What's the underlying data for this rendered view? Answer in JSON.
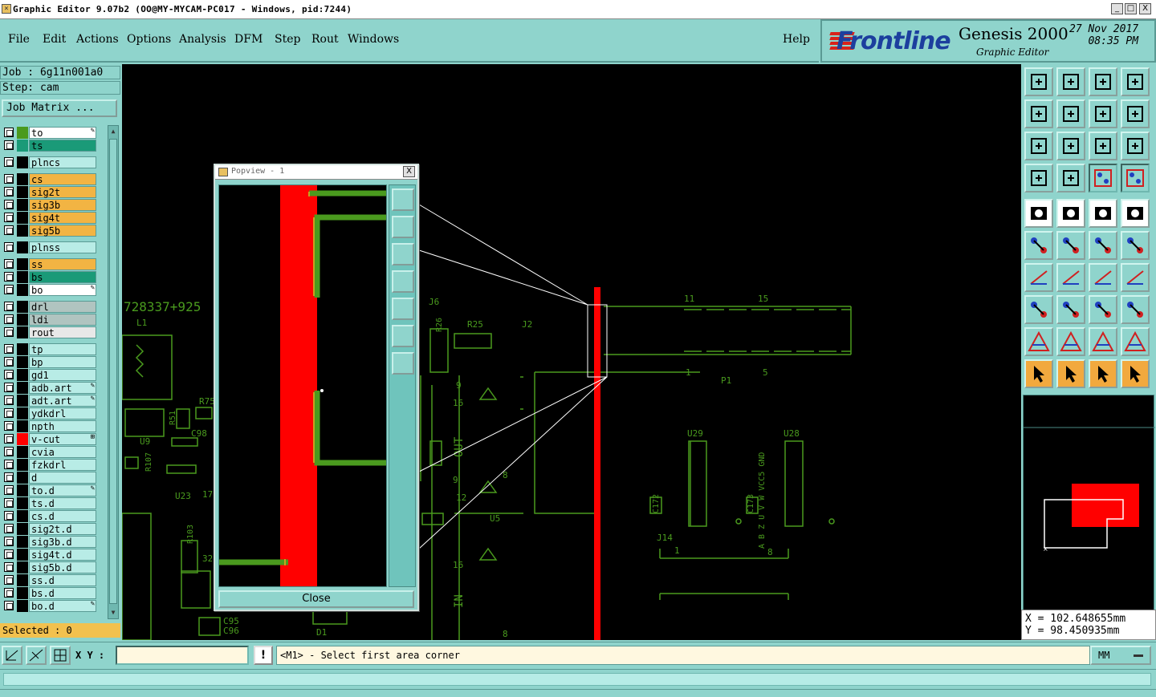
{
  "window": {
    "title": "Graphic Editor 9.07b2 (OO@MY-MYCAM-PC017 - Windows, pid:7244)",
    "minimize": "_",
    "maximize": "□",
    "close": "X"
  },
  "menu": {
    "file": "File",
    "edit": "Edit",
    "actions": "Actions",
    "options": "Options",
    "analysis": "Analysis",
    "dfm": "DFM",
    "step": "Step",
    "rout": "Rout",
    "windows": "Windows",
    "help": "Help"
  },
  "brand": {
    "logo": "Frontline",
    "product": "Genesis 2000",
    "subtitle": "Graphic Editor",
    "date": "27 Nov 2017",
    "time": "08:35 PM"
  },
  "job": {
    "job_label": "Job : 6g11n001a0",
    "step_label": "Step: cam",
    "matrix_button": "Job Matrix ..."
  },
  "layers": [
    {
      "name": "to",
      "color": "#4a9a1e",
      "bg": "#ffffff",
      "mark": "✎"
    },
    {
      "name": "ts",
      "color": "#1a9a78",
      "bg": "#1a9a78",
      "mark": ""
    },
    {
      "name": "plncs",
      "color": "#8fd4cc",
      "bg": "#b8ece6",
      "mark": ""
    },
    {
      "name": "cs",
      "color": "#f2b443",
      "bg": "#f2b443",
      "mark": ""
    },
    {
      "name": "sig2t",
      "color": "#f2b443",
      "bg": "#f2b443",
      "mark": ""
    },
    {
      "name": "sig3b",
      "color": "#f2b443",
      "bg": "#f2b443",
      "mark": ""
    },
    {
      "name": "sig4t",
      "color": "#f2b443",
      "bg": "#f2b443",
      "mark": ""
    },
    {
      "name": "sig5b",
      "color": "#f2b443",
      "bg": "#f2b443",
      "mark": ""
    },
    {
      "name": "plnss",
      "color": "#8fd4cc",
      "bg": "#b8ece6",
      "mark": ""
    },
    {
      "name": "ss",
      "color": "#f2b443",
      "bg": "#f2b443",
      "mark": ""
    },
    {
      "name": "bs",
      "color": "#1a9a78",
      "bg": "#1a9a78",
      "mark": ""
    },
    {
      "name": "bo",
      "color": "#ffffff",
      "bg": "#ffffff",
      "mark": "✎"
    },
    {
      "name": "drl",
      "color": "#8aa8a4",
      "bg": "#b0c4c0",
      "mark": ""
    },
    {
      "name": "ldi",
      "color": "#8aa8a4",
      "bg": "#b0c4c0",
      "mark": ""
    },
    {
      "name": "rout",
      "color": "#d0d0d0",
      "bg": "#e8e8e8",
      "mark": ""
    },
    {
      "name": "tp",
      "color": "#8fd4cc",
      "bg": "#b8ece6",
      "mark": ""
    },
    {
      "name": "bp",
      "color": "#8fd4cc",
      "bg": "#b8ece6",
      "mark": ""
    },
    {
      "name": "gd1",
      "color": "#8fd4cc",
      "bg": "#b8ece6",
      "mark": ""
    },
    {
      "name": "adb.art",
      "color": "#8fd4cc",
      "bg": "#b8ece6",
      "mark": "✎"
    },
    {
      "name": "adt.art",
      "color": "#8fd4cc",
      "bg": "#b8ece6",
      "mark": "✎"
    },
    {
      "name": "ydkdrl",
      "color": "#8fd4cc",
      "bg": "#b8ece6",
      "mark": ""
    },
    {
      "name": "npth",
      "color": "#8fd4cc",
      "bg": "#b8ece6",
      "mark": ""
    },
    {
      "name": "v-cut",
      "color": "#ff0000",
      "bg": "#b8ece6",
      "mark": "⊞"
    },
    {
      "name": "cvia",
      "color": "#8fd4cc",
      "bg": "#b8ece6",
      "mark": ""
    },
    {
      "name": "fzkdrl",
      "color": "#8fd4cc",
      "bg": "#b8ece6",
      "mark": ""
    },
    {
      "name": "d",
      "color": "#8fd4cc",
      "bg": "#b8ece6",
      "mark": ""
    },
    {
      "name": "to.d",
      "color": "#8fd4cc",
      "bg": "#b8ece6",
      "mark": "✎"
    },
    {
      "name": "ts.d",
      "color": "#8fd4cc",
      "bg": "#b8ece6",
      "mark": ""
    },
    {
      "name": "cs.d",
      "color": "#8fd4cc",
      "bg": "#b8ece6",
      "mark": ""
    },
    {
      "name": "sig2t.d",
      "color": "#8fd4cc",
      "bg": "#b8ece6",
      "mark": ""
    },
    {
      "name": "sig3b.d",
      "color": "#8fd4cc",
      "bg": "#b8ece6",
      "mark": ""
    },
    {
      "name": "sig4t.d",
      "color": "#8fd4cc",
      "bg": "#b8ece6",
      "mark": ""
    },
    {
      "name": "sig5b.d",
      "color": "#8fd4cc",
      "bg": "#b8ece6",
      "mark": ""
    },
    {
      "name": "ss.d",
      "color": "#8fd4cc",
      "bg": "#b8ece6",
      "mark": ""
    },
    {
      "name": "bs.d",
      "color": "#8fd4cc",
      "bg": "#b8ece6",
      "mark": ""
    },
    {
      "name": "bo.d",
      "color": "#8fd4cc",
      "bg": "#b8ece6",
      "mark": "✎"
    }
  ],
  "selected_count": "Selected : 0",
  "popview": {
    "title": "Popview - 1",
    "close_button": "Close",
    "close_x": "X"
  },
  "canvas_labels": {
    "coord_text": "728337+925",
    "l1": "L1",
    "j6": "J6",
    "r25": "R25",
    "r26": "R26",
    "j2": "J2",
    "n11": "11",
    "n15": "15",
    "n1": "1",
    "n5": "5",
    "p1": "P1",
    "u29": "U29",
    "u28": "U28",
    "c172": "C172",
    "c173": "C173",
    "j14": "J14",
    "pins": "A B Z U V W VCC5 GND",
    "pin1": "1",
    "pin8": "8",
    "u5": "U5",
    "out": "OUT",
    "in": "IN",
    "n16a": "16",
    "n16b": "16",
    "n9a": "9",
    "n9b": "9",
    "n12": "12",
    "n8a": "8",
    "n8b": "8",
    "u23": "U23",
    "u9": "U9",
    "r75": "R75",
    "r51": "R51",
    "c98": "C98",
    "r107": "R107",
    "r103": "R103",
    "n32": "32",
    "c95": "C95",
    "c96": "C96",
    "d1": "D1",
    "n17": "17"
  },
  "coords": {
    "x": "X = 102.648655mm",
    "y": "Y = 98.450935mm"
  },
  "bottom": {
    "xy_label": "X Y :",
    "xy_value": "",
    "warn": "!",
    "status": "<M1> - Select first area corner",
    "units": "MM"
  },
  "colors": {
    "panel": "#8fd4cc",
    "trace": "#4a9a1e",
    "vcut": "#ff0000",
    "canvas": "#000000"
  }
}
